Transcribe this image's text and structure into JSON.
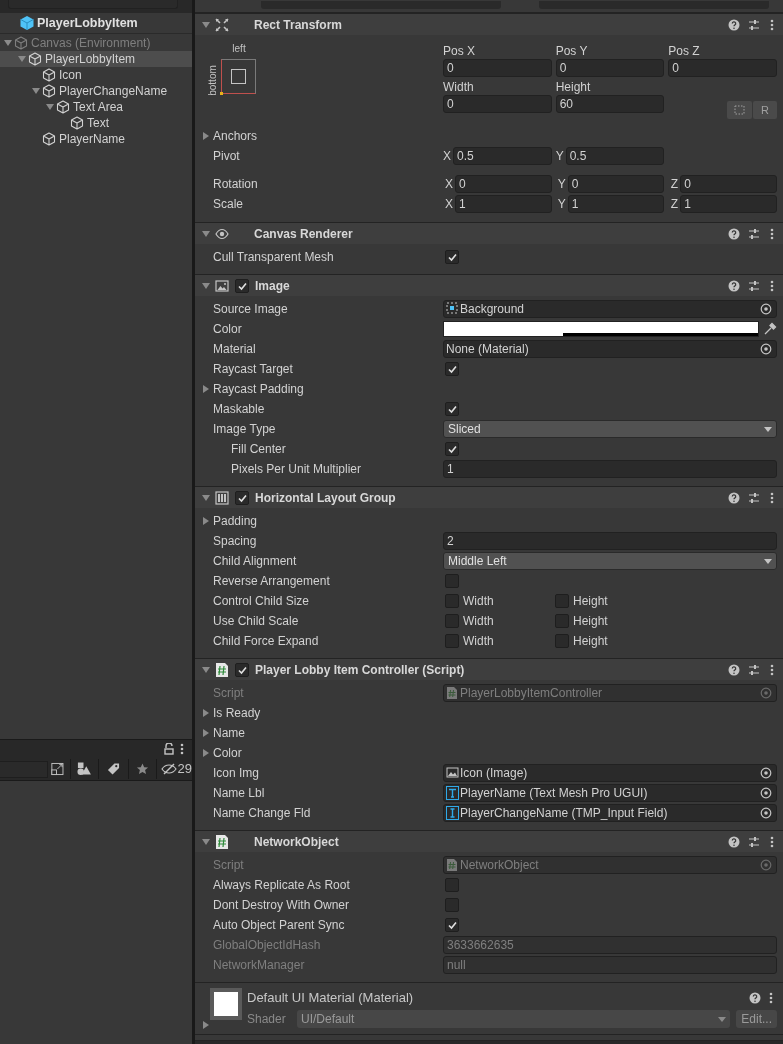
{
  "hierarchy": {
    "title": "PlayerLobbyItem",
    "tree": [
      {
        "label": "Canvas (Environment)",
        "disabled": true,
        "selected": false,
        "expanded": true,
        "children": [
          {
            "label": "PlayerLobbyItem",
            "disabled": false,
            "selected": true,
            "expanded": true,
            "children": [
              {
                "label": "Icon",
                "disabled": false,
                "selected": false
              },
              {
                "label": "PlayerChangeName",
                "disabled": false,
                "selected": false,
                "expanded": true,
                "children": [
                  {
                    "label": "Text Area",
                    "disabled": false,
                    "selected": false,
                    "expanded": true,
                    "children": [
                      {
                        "label": "Text",
                        "disabled": false,
                        "selected": false
                      }
                    ]
                  }
                ]
              },
              {
                "label": "PlayerName",
                "disabled": false,
                "selected": false
              }
            ]
          }
        ]
      }
    ]
  },
  "project": {
    "hidden_count": "29"
  },
  "rect_transform": {
    "title": "Rect Transform",
    "expanded": true,
    "anchor_h": "left",
    "anchor_v": "bottom",
    "fields": [
      {
        "label": "Pos X",
        "value": "0"
      },
      {
        "label": "Pos Y",
        "value": "0"
      },
      {
        "label": "Pos Z",
        "value": "0"
      },
      {
        "label": "Width",
        "value": "0"
      },
      {
        "label": "Height",
        "value": "60"
      }
    ],
    "raw_button": "R",
    "anchors": "Anchors",
    "pivot": {
      "label": "Pivot",
      "axes": [
        {
          "axis": "X",
          "value": "0.5"
        },
        {
          "axis": "Y",
          "value": "0.5"
        }
      ]
    },
    "rotation": {
      "label": "Rotation",
      "axes": [
        {
          "axis": "X",
          "value": "0"
        },
        {
          "axis": "Y",
          "value": "0"
        },
        {
          "axis": "Z",
          "value": "0"
        }
      ]
    },
    "scale": {
      "label": "Scale",
      "axes": [
        {
          "axis": "X",
          "value": "1"
        },
        {
          "axis": "Y",
          "value": "1"
        },
        {
          "axis": "Z",
          "value": "1"
        }
      ]
    }
  },
  "components": [
    {
      "kind": "renderer",
      "title": "Canvas Renderer",
      "expanded": true,
      "rows": [
        {
          "kind": "check",
          "label": "Cull Transparent Mesh",
          "checked": true
        }
      ]
    },
    {
      "kind": "image",
      "title": "Image",
      "enabled": true,
      "expanded": true,
      "rows": [
        {
          "kind": "sprite_ref",
          "label": "Source Image",
          "value": "Background",
          "disabled": false
        },
        {
          "kind": "color",
          "label": "Color",
          "color": "#ffffff"
        },
        {
          "kind": "object",
          "label": "Material",
          "value": "None (Material)",
          "disabled": false
        },
        {
          "kind": "check",
          "label": "Raycast Target",
          "checked": true
        },
        {
          "kind": "foldout",
          "label": "Raycast Padding"
        },
        {
          "kind": "check",
          "label": "Maskable",
          "checked": true
        },
        {
          "kind": "dropdown",
          "label": "Image Type",
          "value": "Sliced",
          "children": [
            {
              "kind": "check",
              "label": "Fill Center",
              "checked": true
            },
            {
              "kind": "field",
              "label": "Pixels Per Unit Multiplier",
              "value": "1",
              "disabled": false
            }
          ]
        }
      ]
    },
    {
      "kind": "layout",
      "title": "Horizontal Layout Group",
      "enabled": true,
      "expanded": true,
      "rows": [
        {
          "kind": "foldout",
          "label": "Padding"
        },
        {
          "kind": "field",
          "label": "Spacing",
          "value": "2",
          "disabled": false
        },
        {
          "kind": "dropdown",
          "label": "Child Alignment",
          "value": "Middle Left"
        },
        {
          "kind": "check",
          "label": "Reverse Arrangement",
          "checked": false
        },
        {
          "kind": "checks",
          "label": "Control Child Size",
          "options": [
            {
              "label": "Width",
              "checked": false
            },
            {
              "label": "Height",
              "checked": false
            }
          ]
        },
        {
          "kind": "checks",
          "label": "Use Child Scale",
          "options": [
            {
              "label": "Width",
              "checked": false
            },
            {
              "label": "Height",
              "checked": false
            }
          ]
        },
        {
          "kind": "checks",
          "label": "Child Force Expand",
          "options": [
            {
              "label": "Width",
              "checked": false
            },
            {
              "label": "Height",
              "checked": false
            }
          ]
        }
      ]
    },
    {
      "kind": "script",
      "title": "Player Lobby Item Controller (Script)",
      "enabled": true,
      "expanded": true,
      "rows": [
        {
          "kind": "script_ref",
          "label": "Script",
          "value": "PlayerLobbyItemController",
          "disabled": true
        },
        {
          "kind": "foldout",
          "label": "Is Ready"
        },
        {
          "kind": "foldout",
          "label": "Name"
        },
        {
          "kind": "foldout",
          "label": "Color"
        },
        {
          "kind": "image_ref",
          "label": "Icon Img",
          "value": "Icon (Image)",
          "disabled": false
        },
        {
          "kind": "text_ref",
          "label": "Name Lbl",
          "value": "PlayerName (Text Mesh Pro UGUI)",
          "disabled": false
        },
        {
          "kind": "input_ref",
          "label": "Name Change Fld",
          "value": "PlayerChangeName (TMP_Input Field)",
          "disabled": false
        }
      ]
    },
    {
      "kind": "script",
      "title": "NetworkObject",
      "expanded": true,
      "rows": [
        {
          "kind": "script_ref",
          "label": "Script",
          "value": "NetworkObject",
          "disabled": true
        },
        {
          "kind": "check",
          "label": "Always Replicate As Root",
          "checked": false
        },
        {
          "kind": "check",
          "label": "Dont Destroy With Owner",
          "checked": false
        },
        {
          "kind": "check",
          "label": "Auto Object Parent Sync",
          "checked": true
        },
        {
          "kind": "field",
          "label": "GlobalObjectIdHash",
          "value": "3633662635",
          "disabled": true
        },
        {
          "kind": "field",
          "label": "NetworkManager",
          "value": "null",
          "disabled": true
        }
      ]
    }
  ],
  "material": {
    "title": "Default UI Material (Material)",
    "shader_label": "Shader",
    "shader": "UI/Default",
    "edit_button": "Edit...",
    "expanded": false
  }
}
